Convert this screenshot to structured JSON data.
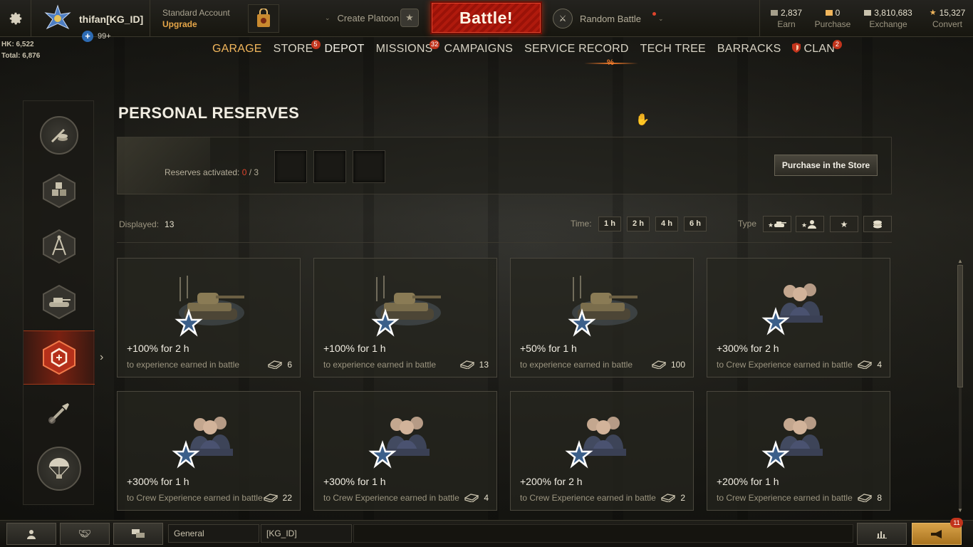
{
  "player": {
    "name": "thifan[KG_ID]",
    "premium_count": "99+",
    "hk": "HK: 6,522",
    "total": "Total: 6,876"
  },
  "account": {
    "type": "Standard Account",
    "upgrade": "Upgrade"
  },
  "platoon": {
    "label": "Create Platoon"
  },
  "battle": {
    "label": "Battle!"
  },
  "battle_mode": {
    "label": "Random Battle"
  },
  "currencies": [
    {
      "amount": "2,837",
      "label": "Earn",
      "icon": "credits-icon",
      "color": "#c9c2ad"
    },
    {
      "amount": "0",
      "label": "Purchase",
      "icon": "gold-icon",
      "color": "#f1b65c"
    },
    {
      "amount": "3,810,683",
      "label": "Exchange",
      "icon": "silver-icon",
      "color": "#c9c2ad"
    },
    {
      "amount": "15,327",
      "label": "Convert",
      "icon": "free-xp-star-icon",
      "color": "#f1b65c"
    }
  ],
  "nav": {
    "items": [
      {
        "label": "GARAGE",
        "badge": ""
      },
      {
        "label": "STORE",
        "badge": "5"
      },
      {
        "label": "DEPOT",
        "badge": ""
      },
      {
        "label": "MISSIONS",
        "badge": "32"
      },
      {
        "label": "CAMPAIGNS",
        "badge": ""
      },
      {
        "label": "SERVICE RECORD",
        "badge": ""
      },
      {
        "label": "TECH TREE",
        "badge": ""
      },
      {
        "label": "BARRACKS",
        "badge": ""
      },
      {
        "label": "CLAN",
        "badge": "2"
      }
    ],
    "tech_tree_marker": "%"
  },
  "page": {
    "title": "PERSONAL RESERVES",
    "reserves_activated_label": "Reserves activated:",
    "reserves_activated_count": "0",
    "reserves_activated_total": "/ 3",
    "purchase_button": "Purchase in the Store",
    "displayed_label": "Displayed:",
    "displayed_count": "13",
    "time_label": "Time:",
    "time_filters": [
      "1 h",
      "2 h",
      "4 h",
      "6 h"
    ],
    "type_label": "Type"
  },
  "cards": [
    {
      "title": "+100% for 2 h",
      "desc": "to experience earned in battle",
      "count": "6",
      "art": "tank"
    },
    {
      "title": "+100% for 1 h",
      "desc": "to experience earned in battle",
      "count": "13",
      "art": "tank"
    },
    {
      "title": "+50% for 1 h",
      "desc": "to experience earned in battle",
      "count": "100",
      "art": "tank"
    },
    {
      "title": "+300% for 2 h",
      "desc": "to Crew Experience earned in battle",
      "count": "4",
      "art": "crew"
    },
    {
      "title": "+300% for 1 h",
      "desc": "to Crew Experience earned in battle",
      "count": "22",
      "art": "crew"
    },
    {
      "title": "+300% for 1 h",
      "desc": "to Crew Experience earned in battle",
      "count": "4",
      "art": "crew"
    },
    {
      "title": "+200% for 2 h",
      "desc": "to Crew Experience earned in battle",
      "count": "2",
      "art": "crew"
    },
    {
      "title": "+200% for 1 h",
      "desc": "to Crew Experience earned in battle",
      "count": "8",
      "art": "crew"
    }
  ],
  "chat": {
    "tabs": [
      "General",
      "[KG_ID]"
    ],
    "notifications": "11"
  },
  "colors": {
    "accent": "#f1b65c",
    "battle": "#b01a0d",
    "badge": "#c2341c"
  }
}
